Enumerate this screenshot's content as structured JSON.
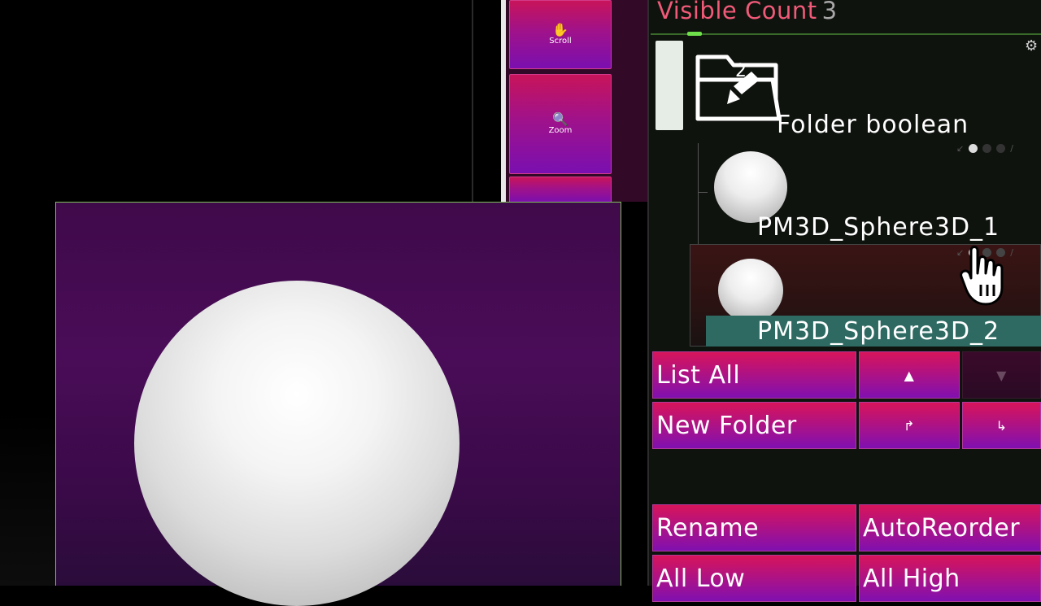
{
  "palette": {
    "scroll_label": "Scroll",
    "zoom_label": "Zoom"
  },
  "subtool": {
    "visible_count_label": "Visible Count",
    "visible_count_value": "3",
    "folder_badge": "2",
    "folder_name": "Folder boolean",
    "items": [
      {
        "name": "PM3D_Sphere3D_1"
      },
      {
        "name": "PM3D_Sphere3D_2",
        "selected": true
      }
    ]
  },
  "buttons": {
    "list_all": "List All",
    "new_folder": "New Folder",
    "rename": "Rename",
    "auto_reorder": "AutoReorder",
    "all_low": "All Low",
    "all_high": "All High"
  },
  "colors": {
    "accent_title": "#f05a78",
    "button_top": "#d8145a",
    "button_bottom": "#8010b0",
    "selected_row": "#2e6a62",
    "viewport_bg": "#3f0a4a"
  },
  "icons": [
    "scroll-icon",
    "zoom-icon",
    "gear-icon",
    "folder-brush-icon",
    "arrow-up-icon",
    "arrow-down-icon",
    "move-up-right-icon",
    "move-right-icon",
    "hand-cursor-icon"
  ]
}
